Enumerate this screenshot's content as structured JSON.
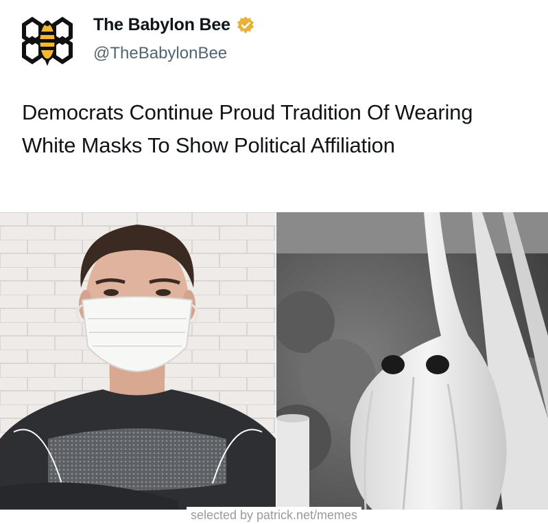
{
  "tweet": {
    "display_name": "The Babylon Bee",
    "handle": "@TheBabylonBee",
    "verified_icon": "verified-badge-gold",
    "avatar_icon": "bee-logo",
    "text_line1": "Democrats Continue Proud Tradition Of Wearing",
    "text_line2": "White Masks To Show Political Affiliation"
  },
  "media": {
    "left_image": "man-in-surgical-mask",
    "right_image": "white-hooded-robe-grayscale"
  },
  "footer": {
    "watermark": "selected by patrick.net/memes"
  },
  "colors": {
    "brand_gold": "#f2b733",
    "text_primary": "#0f1419",
    "text_secondary": "#536471"
  }
}
